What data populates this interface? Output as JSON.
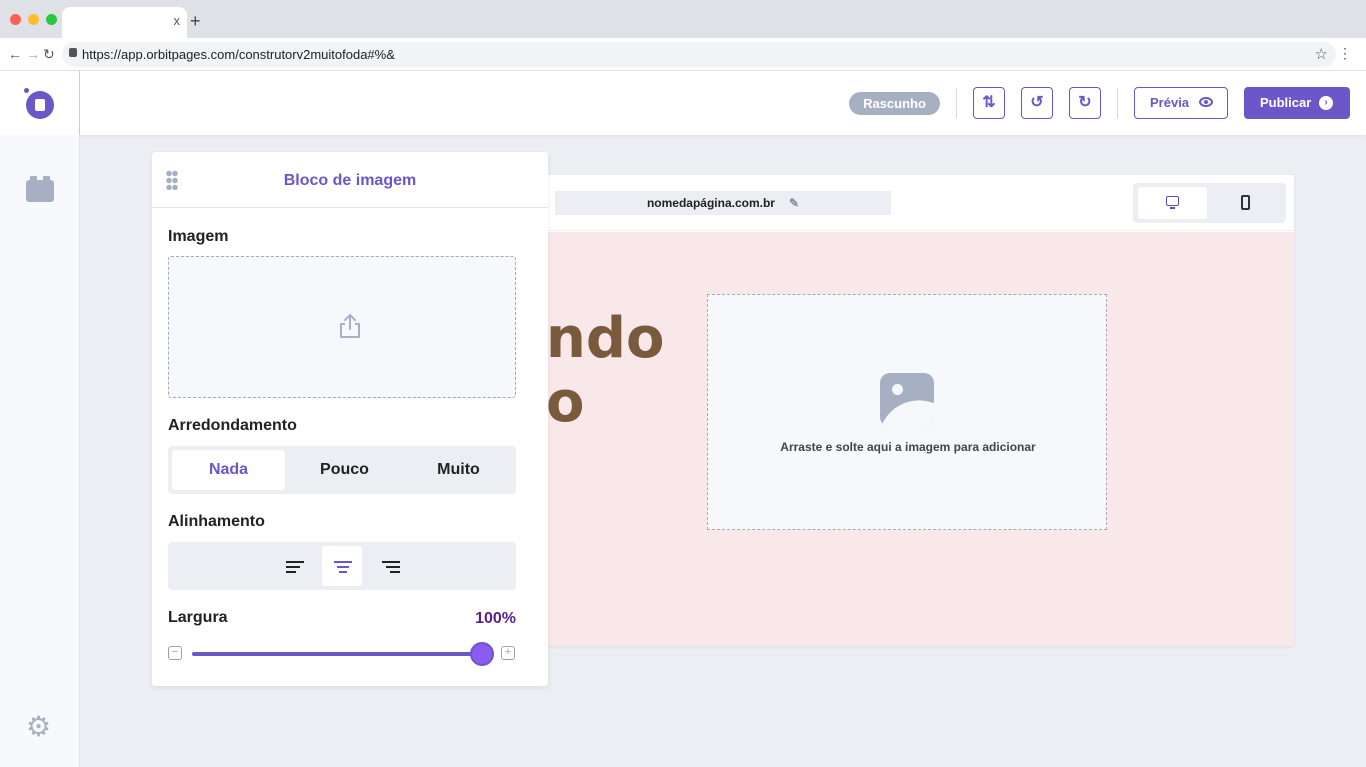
{
  "browser": {
    "tab_title": "",
    "tab_close": "x",
    "new_tab": "+",
    "url": "https://app.orbitpages.com/construtorv2muitofoda#%&"
  },
  "header": {
    "status_badge": "Rascunho",
    "preview_label": "Prévia",
    "publish_label": "Publicar"
  },
  "canvas": {
    "domain": "nomedapágina.com.br",
    "hero_line1": "ndo",
    "hero_line2": "o",
    "dropzone_text": "Arraste e solte aqui a imagem para adicionar"
  },
  "panel": {
    "title": "Bloco de imagem",
    "image_label": "Imagem",
    "rounding_label": "Arredondamento",
    "rounding_options": [
      "Nada",
      "Pouco",
      "Muito"
    ],
    "rounding_selected": "Nada",
    "alignment_label": "Alinhamento",
    "alignment_options": [
      "align-left-icon",
      "align-center-icon",
      "align-right-icon"
    ],
    "alignment_selected": "center",
    "width_label": "Largura",
    "width_value": "100%",
    "width_fraction": 1.0
  },
  "colors": {
    "accent": "#6b57c8",
    "canvas_bg": "#f9e8e9",
    "badge": "#a7b0c3",
    "hero_text": "#7a5a3c"
  }
}
